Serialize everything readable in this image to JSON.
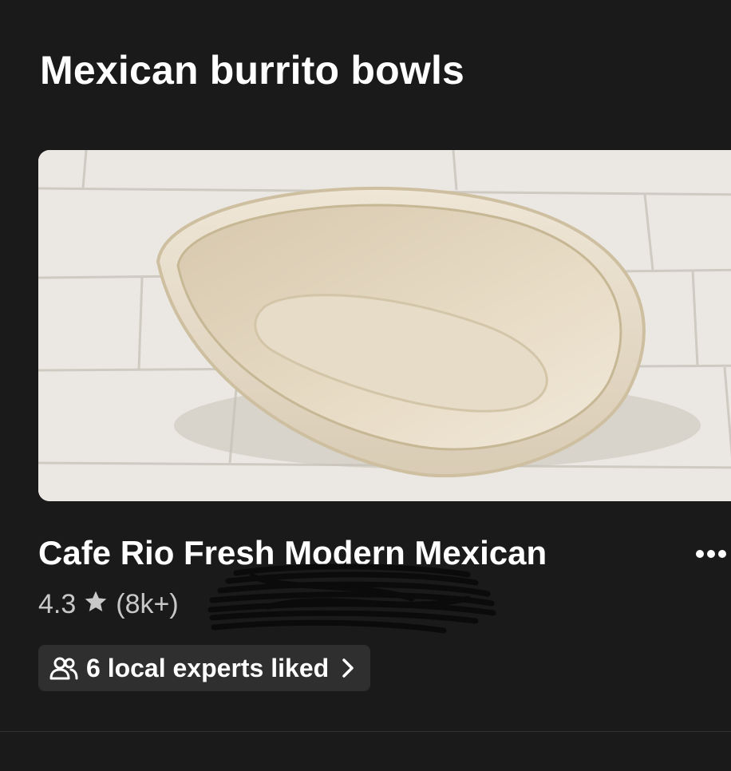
{
  "section": {
    "title": "Mexican burrito bowls"
  },
  "store": {
    "name": "Cafe Rio Fresh Modern Mexican",
    "rating": "4.3",
    "review_count": "(8k+)",
    "image_icon": "burrito-bowl-photo"
  },
  "experts": {
    "label": "6 local experts liked",
    "icon": "people-icon",
    "chevron": "chevron-right-icon"
  },
  "more_menu": {
    "icon": "ellipsis-icon"
  },
  "colors": {
    "background": "#1a1a1a",
    "chip_background": "#2f2f2f",
    "text_primary": "#ffffff",
    "text_secondary": "#c8c8c8"
  }
}
